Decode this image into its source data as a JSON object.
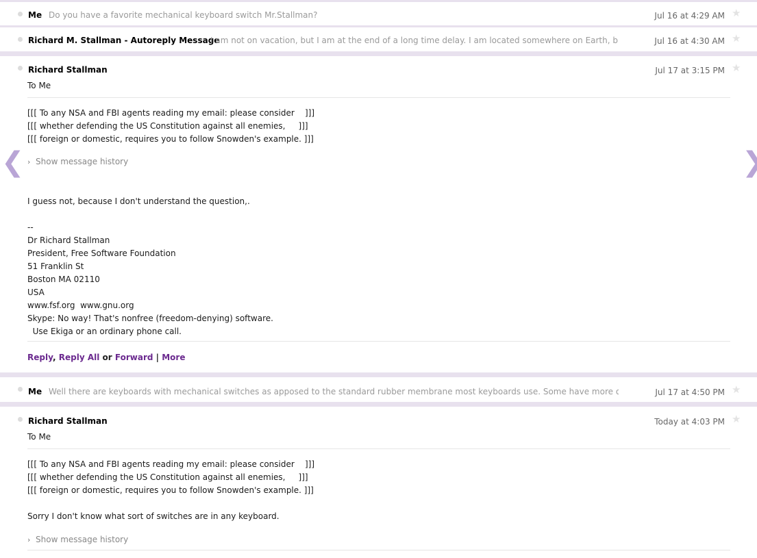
{
  "thread": {
    "row1": {
      "sender": "Me",
      "snippet": "Do you have a favorite mechanical keyboard switch Mr.Stallman?",
      "date": "Jul 16 at 4:29 AM"
    },
    "row2": {
      "sender": "Richard M. Stallman - Autoreply Message",
      "snippet": "I am not on vacation, but I am at the end of a long time delay. I am located somewhere on Earth, but a",
      "date": "Jul 16 at 4:30 AM"
    },
    "msg1": {
      "sender": "Richard Stallman",
      "date": "Jul 17 at 3:15 PM",
      "to": "To  Me",
      "notice": [
        "[[[ To any NSA and FBI agents reading my email: please consider    ]]]",
        "[[[ whether defending the US Constitution against all enemies,     ]]]",
        "[[[ foreign or domestic, requires you to follow Snowden's example. ]]]"
      ],
      "history_label": "Show message history",
      "body": [
        "I guess not, because I don't understand the question,.",
        "",
        "--",
        "Dr Richard Stallman",
        "President, Free Software Foundation",
        "51 Franklin St",
        "Boston MA 02110",
        "USA",
        "www.fsf.org  www.gnu.org",
        "Skype: No way! That's nonfree (freedom-denying) software.",
        "  Use Ekiga or an ordinary phone call."
      ],
      "actions": {
        "reply": "Reply",
        "comma": ",",
        "reply_all": "Reply All",
        "or": "or",
        "forward": "Forward",
        "pipe": "|",
        "more": "More"
      }
    },
    "row3": {
      "sender": "Me",
      "snippet": "Well there are keyboards with mechanical switches as apposed to the standard rubber membrane most keyboards use. Some have more or le",
      "date": "Jul 17 at 4:50 PM"
    },
    "msg2": {
      "sender": "Richard Stallman",
      "date": "Today at 4:03 PM",
      "to": "To  Me",
      "notice": [
        "[[[ To any NSA and FBI agents reading my email: please consider    ]]]",
        "[[[ whether defending the US Constitution against all enemies,     ]]]",
        "[[[ foreign or domestic, requires you to follow Snowden's example. ]]]"
      ],
      "body": [
        "Sorry I don't know what sort of switches are in any keyboard."
      ],
      "history_label": "Show message history"
    }
  },
  "icons": {
    "star": "★",
    "prev": "❮",
    "next": "❯",
    "history_chevron": "›"
  },
  "colors": {
    "accent": "#6b2a8f",
    "separator": "#e8e1ee",
    "arrow": "#b9a5d6"
  }
}
